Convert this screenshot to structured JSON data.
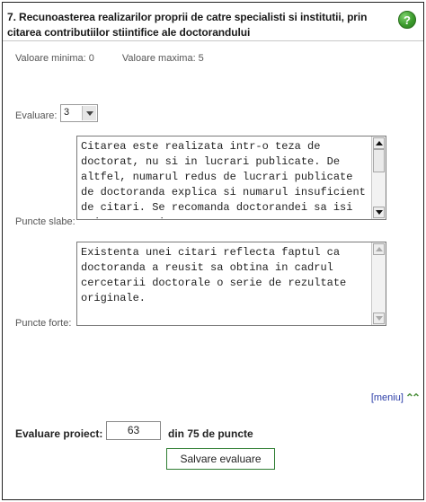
{
  "header": {
    "title": "7. Recunoasterea realizarilor proprii de catre specialisti si institutii, prin citarea contributiilor stiintifice ale doctorandului",
    "help_glyph": "?"
  },
  "range": {
    "min_label": "Valoare minima: 0",
    "max_label": "Valoare maxima: 5"
  },
  "evaluation": {
    "label": "Evaluare:",
    "selected": "3"
  },
  "weak_points": {
    "label": "Puncte slabe:",
    "text": "Citarea este realizata intr-o teza de doctorat, nu si in lucrari publicate. De altfel, numarul redus de lucrari publicate de doctoranda explica si numarul insuficient de citari. Se recomanda doctorandei sa isi asigure o mai mare"
  },
  "strong_points": {
    "label": "Puncte forte:",
    "text": "Existenta unei citari reflecta faptul ca doctoranda a reusit sa obtina in cadrul cercetarii doctorale o serie de rezultate originale."
  },
  "menu": {
    "label": "[meniu]",
    "icon": "double-up-arrow-icon"
  },
  "project": {
    "label": "Evaluare proiect:",
    "value": "63",
    "suffix": "din 75 de puncte"
  },
  "actions": {
    "save_label": "Salvare evaluare"
  }
}
